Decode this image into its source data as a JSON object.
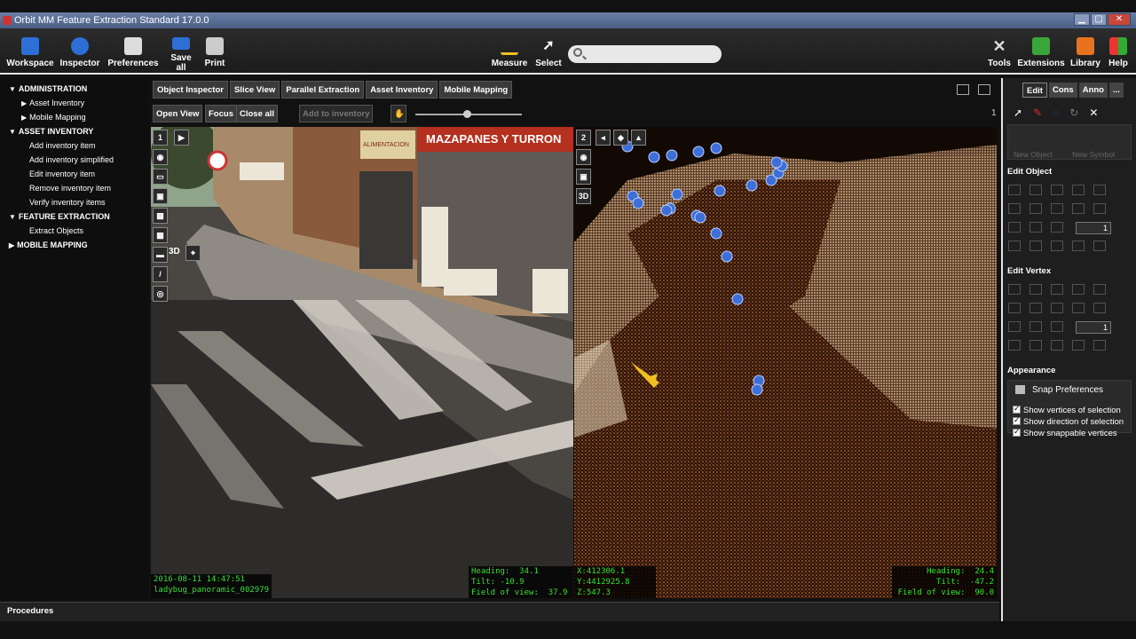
{
  "window": {
    "title": "Orbit MM Feature Extraction Standard 17.0.0"
  },
  "toolbar": {
    "workspace": "Workspace",
    "inspector": "Inspector",
    "preferences": "Preferences",
    "save_all": "Save all",
    "print": "Print",
    "measure": "Measure",
    "select": "Select",
    "tools": "Tools",
    "extensions": "Extensions",
    "library": "Library",
    "help": "Help",
    "search_placeholder": ""
  },
  "tree": {
    "administration": "ADMINISTRATION",
    "admin_items": [
      "Asset Inventory",
      "Mobile Mapping"
    ],
    "asset_inventory": "ASSET INVENTORY",
    "asset_items": [
      "Add inventory item",
      "Add inventory simplified",
      "Edit inventory item",
      "Remove inventory item",
      "Verify inventory items"
    ],
    "feature_extraction": "FEATURE EXTRACTION",
    "feature_items": [
      "Extract Objects"
    ],
    "mobile_mapping": "MOBILE MAPPING"
  },
  "view_tabs": [
    "Object Inspector",
    "Slice View",
    "Parallel Extraction",
    "Asset Inventory",
    "Mobile Mapping"
  ],
  "view_subbar": {
    "open_view": "Open View",
    "focus": "Focus",
    "close_all": "Close all",
    "add_to_inventory": "Add to inventory",
    "page": "1",
    "slider_value": 0.48
  },
  "left_view": {
    "id": "1",
    "mode_3d": "3D",
    "timestamp": "2016-08-11 14:47:51",
    "image_name": "ladybug_panoramic_002979",
    "heading_line": "Heading:  34.1",
    "tilt_line": "Tilt: -10.9",
    "fov_line": "Field of view:  37.9",
    "x_line": "X:412306.1",
    "y_line": "Y:4412925.8",
    "z_line": "Z:547.3",
    "shop_sign": "ALIMENTACION",
    "shop_sign2": "MAZAPANES Y TURRON"
  },
  "right_view": {
    "id": "2",
    "mode_3d": "3D",
    "heading_line": "Heading:  24.4",
    "tilt_line": "Tilt:  -47.2",
    "fov_line": "Field of view:  90.0"
  },
  "right_panel": {
    "tabs": [
      "Edit",
      "Cons",
      "Anno",
      "..."
    ],
    "new_object": "New Object",
    "new_symbol": "New Symbol",
    "edit_object": "Edit Object",
    "edit_object_value": "1",
    "edit_vertex": "Edit Vertex",
    "edit_vertex_value": "1",
    "appearance": "Appearance",
    "snap_preferences": "Snap Preferences",
    "checks": [
      "Show vertices of selection",
      "Show direction of selection",
      "Show snappable vertices"
    ]
  },
  "bottom": {
    "procedures": "Procedures"
  },
  "colors": {
    "accent_yellow": "#f0c020",
    "hud_green": "#35e035",
    "marker_blue": "#3e6fd8"
  }
}
